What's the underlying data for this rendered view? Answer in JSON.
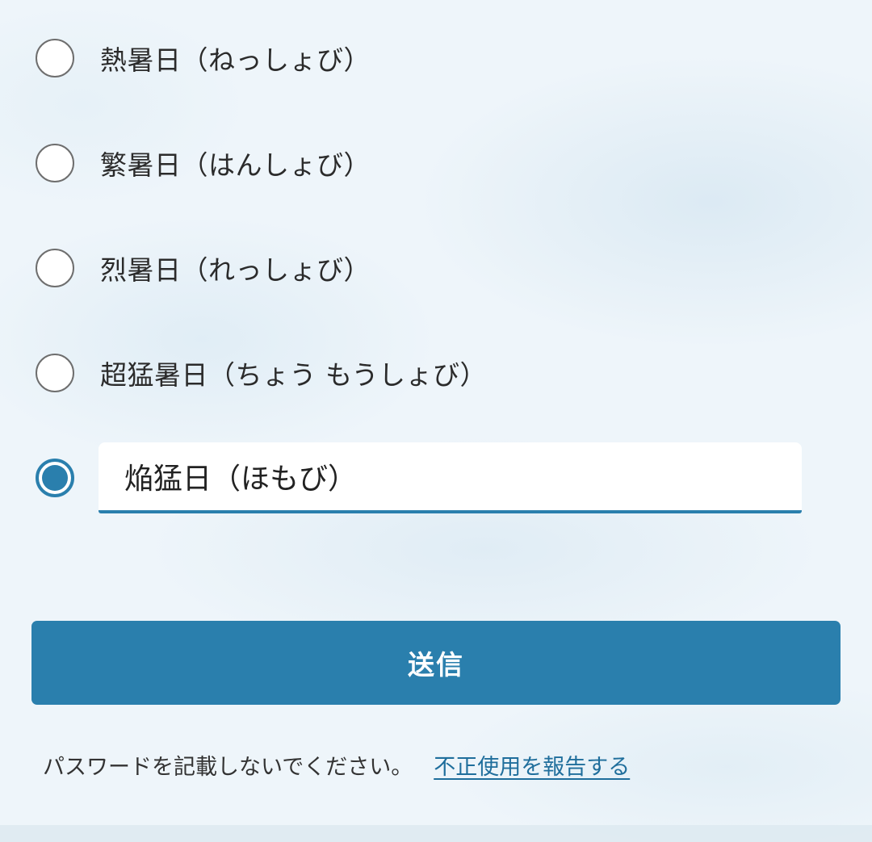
{
  "options": [
    {
      "label": "熱暑日（ねっしょび）",
      "selected": false
    },
    {
      "label": "繁暑日（はんしょび）",
      "selected": false
    },
    {
      "label": "烈暑日（れっしょび）",
      "selected": false
    },
    {
      "label": "超猛暑日（ちょう もうしょび）",
      "selected": false
    },
    {
      "selected": true
    }
  ],
  "custom_input": {
    "value": "焔猛日（ほもび）"
  },
  "submit": {
    "label": "送信"
  },
  "footer": {
    "notice": "パスワードを記載しないでください。",
    "report_link": "不正使用を報告する"
  },
  "colors": {
    "accent": "#2a7fad",
    "radio_border": "#6e6e6e",
    "link": "#1f6e9c"
  }
}
